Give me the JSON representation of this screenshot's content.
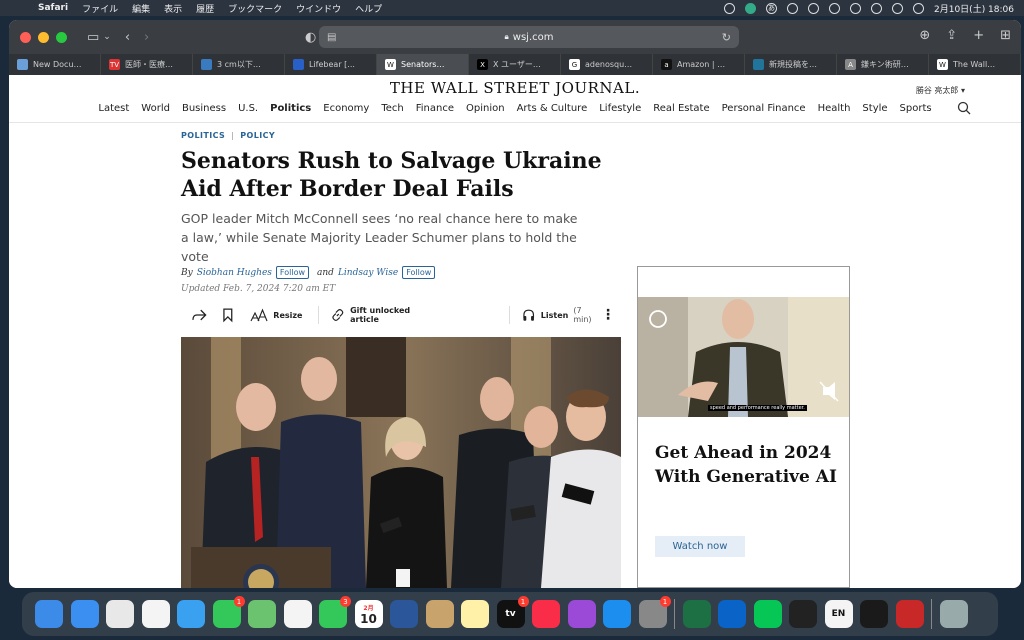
{
  "menubar": {
    "app": "Safari",
    "items": [
      "ファイル",
      "編集",
      "表示",
      "履歴",
      "ブックマーク",
      "ウインドウ",
      "ヘルプ"
    ],
    "ime": "あ",
    "datetime": "2月10日(土)  18:06"
  },
  "browser": {
    "url": "wsj.com",
    "tabs": [
      {
        "label": "New Docu…",
        "color": "#6a9fd8",
        "glyph": ""
      },
      {
        "label": "医師・医療…",
        "color": "#d33",
        "glyph": "TV"
      },
      {
        "label": "3 cm以下…",
        "color": "#3a7bbf",
        "glyph": ""
      },
      {
        "label": "Lifebear [...",
        "color": "#2860c8",
        "glyph": ""
      },
      {
        "label": "Senators…",
        "color": "#fff",
        "glyph": "W"
      },
      {
        "label": "X ユーザー…",
        "color": "#000",
        "glyph": "X"
      },
      {
        "label": "adenosqu…",
        "color": "#fff",
        "glyph": "G"
      },
      {
        "label": "Amazon | …",
        "color": "#111",
        "glyph": "a"
      },
      {
        "label": "新規投稿を…",
        "color": "#21759b",
        "glyph": ""
      },
      {
        "label": "鎌キン術研…",
        "color": "#888",
        "glyph": "A"
      },
      {
        "label": "The Wall…",
        "color": "#fff",
        "glyph": "W"
      }
    ],
    "active_tab": 4
  },
  "site": {
    "masthead": "THE WALL STREET JOURNAL.",
    "user": "勝谷 亮太郎 ▾",
    "nav": [
      "Latest",
      "World",
      "Business",
      "U.S.",
      "Politics",
      "Economy",
      "Tech",
      "Finance",
      "Opinion",
      "Arts & Culture",
      "Lifestyle",
      "Real Estate",
      "Personal Finance",
      "Health",
      "Style",
      "Sports"
    ],
    "nav_bold": "Politics"
  },
  "article": {
    "kicker1": "POLITICS",
    "kicker2": "POLICY",
    "headline": "Senators Rush to Salvage Ukraine Aid After Border Deal Fails",
    "dek": "GOP leader Mitch McConnell sees ‘no real chance here to make a law,’ while Senate Majority Leader Schumer plans to hold the vote",
    "by": "By",
    "author1": "Siobhan Hughes",
    "and": "and",
    "author2": "Lindsay Wise",
    "follow": "Follow",
    "updated": "Updated Feb. 7, 2024 7:20 am ET",
    "tools": {
      "resize": "Resize",
      "gift": "Gift unlocked article",
      "listen": "Listen",
      "listen_time": "(7 min)"
    }
  },
  "ad": {
    "title": "Get Ahead in 2024 With Generative AI",
    "button": "Watch now",
    "caption": "speed and performance really matter."
  },
  "dock": [
    {
      "name": "finder",
      "color": "#3d8be8",
      "badge": ""
    },
    {
      "name": "mail",
      "color": "#3b8ff0",
      "badge": ""
    },
    {
      "name": "launchpad",
      "color": "#e8e8e8",
      "badge": ""
    },
    {
      "name": "reminders",
      "color": "#f4f4f4",
      "badge": ""
    },
    {
      "name": "safari",
      "color": "#3aa0f0",
      "badge": ""
    },
    {
      "name": "messages",
      "color": "#34c759",
      "badge": "1"
    },
    {
      "name": "maps",
      "color": "#6cc36f",
      "badge": ""
    },
    {
      "name": "photos",
      "color": "#f4f4f4",
      "badge": ""
    },
    {
      "name": "facetime",
      "color": "#34c759",
      "badge": "3"
    },
    {
      "name": "calendar",
      "color": "#fff",
      "badge": ""
    },
    {
      "name": "word",
      "color": "#2b579a",
      "badge": ""
    },
    {
      "name": "contacts",
      "color": "#c9a36c",
      "badge": ""
    },
    {
      "name": "notes",
      "color": "#fff2a8",
      "badge": ""
    },
    {
      "name": "apple-tv",
      "color": "#111",
      "badge": "1"
    },
    {
      "name": "music",
      "color": "#fa2d48",
      "badge": ""
    },
    {
      "name": "podcasts",
      "color": "#9b4ad8",
      "badge": ""
    },
    {
      "name": "app-store",
      "color": "#1c8ef0",
      "badge": ""
    },
    {
      "name": "system-settings",
      "color": "#888",
      "badge": "1"
    },
    {
      "name": "excel",
      "color": "#1d7044",
      "badge": ""
    },
    {
      "name": "outlook",
      "color": "#0a64c8",
      "badge": ""
    },
    {
      "name": "line",
      "color": "#06c755",
      "badge": ""
    },
    {
      "name": "stocks",
      "color": "#222",
      "badge": ""
    },
    {
      "name": "en-input",
      "color": "#f4f4f4",
      "badge": ""
    },
    {
      "name": "kindle",
      "color": "#1a1a1a",
      "badge": ""
    },
    {
      "name": "preview",
      "color": "#c82828",
      "badge": ""
    },
    {
      "name": "trash",
      "color": "#9aa",
      "badge": ""
    }
  ],
  "dock_labels": {
    "calendar_month": "2月",
    "calendar_day": "10",
    "en": "EN",
    "tv": "tv"
  }
}
